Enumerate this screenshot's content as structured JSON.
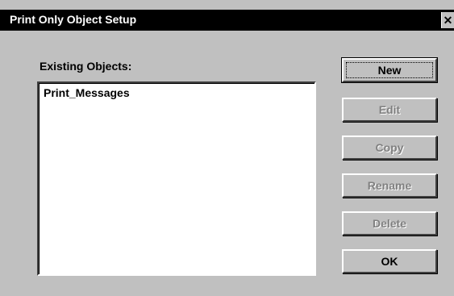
{
  "window": {
    "title": "Print Only Object Setup",
    "close_glyph": "✕"
  },
  "list": {
    "label": "Existing Objects:",
    "items": [
      "Print_Messages"
    ]
  },
  "buttons": {
    "new": "New",
    "edit": "Edit",
    "copy": "Copy",
    "rename": "Rename",
    "delete": "Delete",
    "ok": "OK"
  }
}
